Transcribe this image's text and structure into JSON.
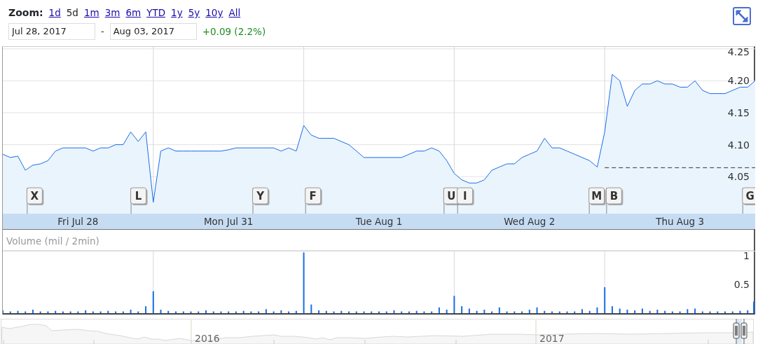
{
  "zoom": {
    "label": "Zoom:",
    "options": [
      {
        "label": "1d",
        "selected": false
      },
      {
        "label": "5d",
        "selected": true
      },
      {
        "label": "1m",
        "selected": false
      },
      {
        "label": "3m",
        "selected": false
      },
      {
        "label": "6m",
        "selected": false
      },
      {
        "label": "YTD",
        "selected": false
      },
      {
        "label": "1y",
        "selected": false
      },
      {
        "label": "5y",
        "selected": false
      },
      {
        "label": "10y",
        "selected": false
      },
      {
        "label": "All",
        "selected": false
      }
    ]
  },
  "date_range": {
    "start": "Jul 28, 2017",
    "separator": "-",
    "end": "Aug 03, 2017",
    "change": "+0.09 (2.2%)"
  },
  "price_chart": {
    "news_flags": [
      {
        "letter": "X"
      },
      {
        "letter": "L"
      },
      {
        "letter": "Y"
      },
      {
        "letter": "F"
      },
      {
        "letter": "U"
      },
      {
        "letter": "I"
      },
      {
        "letter": "M"
      },
      {
        "letter": "B"
      },
      {
        "letter": "G"
      }
    ],
    "date_labels": [
      "Fri Jul 28",
      "Mon Jul 31",
      "Tue Aug 1",
      "Wed Aug 2",
      "Thu Aug 3"
    ],
    "chart_data": {
      "type": "area",
      "grid": true,
      "ylim": [
        3.992,
        4.253
      ],
      "yticks": [
        {
          "value": 4.05,
          "label": "4.05"
        },
        {
          "value": 4.1,
          "label": "4.10"
        },
        {
          "value": 4.15,
          "label": "4.15"
        },
        {
          "value": 4.2,
          "label": "4.20"
        },
        {
          "value": 4.25,
          "label": "4.25"
        }
      ],
      "ref_lines": [
        {
          "axis": "y",
          "value": 4.064
        }
      ],
      "series": [
        {
          "color": "#1a6ee6",
          "values": [
            4.085,
            4.08,
            4.082,
            4.06,
            4.068,
            4.07,
            4.075,
            4.09,
            4.095,
            4.095,
            4.095,
            4.095,
            4.09,
            4.095,
            4.095,
            4.1,
            4.1,
            4.12,
            4.105,
            4.12,
            4.01,
            4.09,
            4.095,
            4.09,
            4.09,
            4.09,
            4.09,
            4.09,
            4.09,
            4.09,
            4.092,
            4.095,
            4.095,
            4.095,
            4.095,
            4.095,
            4.095,
            4.09,
            4.095,
            4.09,
            4.13,
            4.115,
            4.11,
            4.11,
            4.11,
            4.105,
            4.1,
            4.09,
            4.08,
            4.08,
            4.08,
            4.08,
            4.08,
            4.08,
            4.085,
            4.09,
            4.09,
            4.095,
            4.09,
            4.075,
            4.055,
            4.045,
            4.04,
            4.04,
            4.045,
            4.06,
            4.065,
            4.07,
            4.07,
            4.08,
            4.085,
            4.09,
            4.11,
            4.095,
            4.095,
            4.09,
            4.085,
            4.08,
            4.075,
            4.065,
            4.12,
            4.21,
            4.2,
            4.16,
            4.185,
            4.195,
            4.195,
            4.2,
            4.195,
            4.195,
            4.19,
            4.19,
            4.2,
            4.185,
            4.18,
            4.18,
            4.18,
            4.185,
            4.19,
            4.19,
            4.2
          ]
        }
      ]
    }
  },
  "volume_chart": {
    "label": "Volume (mil / 2min)",
    "chart_data": {
      "type": "bar",
      "grid": true,
      "ylim": [
        0,
        1.08
      ],
      "yticks": [
        0.5,
        1
      ],
      "series": [
        {
          "color": "#1a6ee6",
          "values": [
            0.05,
            0.03,
            0.04,
            0.03,
            0.06,
            0.03,
            0.03,
            0.04,
            0.03,
            0.03,
            0.03,
            0.05,
            0.03,
            0.03,
            0.04,
            0.03,
            0.03,
            0.06,
            0.03,
            0.12,
            0.38,
            0.06,
            0.04,
            0.03,
            0.03,
            0.03,
            0.03,
            0.05,
            0.03,
            0.03,
            0.03,
            0.03,
            0.04,
            0.03,
            0.03,
            0.07,
            0.03,
            0.05,
            0.03,
            0.04,
            1.05,
            0.15,
            0.05,
            0.04,
            0.03,
            0.04,
            0.03,
            0.03,
            0.03,
            0.03,
            0.03,
            0.03,
            0.05,
            0.03,
            0.03,
            0.04,
            0.03,
            0.03,
            0.1,
            0.06,
            0.3,
            0.12,
            0.08,
            0.04,
            0.06,
            0.03,
            0.1,
            0.03,
            0.03,
            0.03,
            0.06,
            0.1,
            0.04,
            0.03,
            0.03,
            0.03,
            0.03,
            0.07,
            0.04,
            0.1,
            0.45,
            0.12,
            0.08,
            0.06,
            0.05,
            0.08,
            0.04,
            0.06,
            0.04,
            0.03,
            0.03,
            0.07,
            0.08,
            0.03,
            0.03,
            0.03,
            0.03,
            0.03,
            0.04,
            0.05,
            0.2
          ]
        }
      ]
    }
  },
  "navigator": {
    "labels": [
      "2016",
      "2017"
    ]
  }
}
